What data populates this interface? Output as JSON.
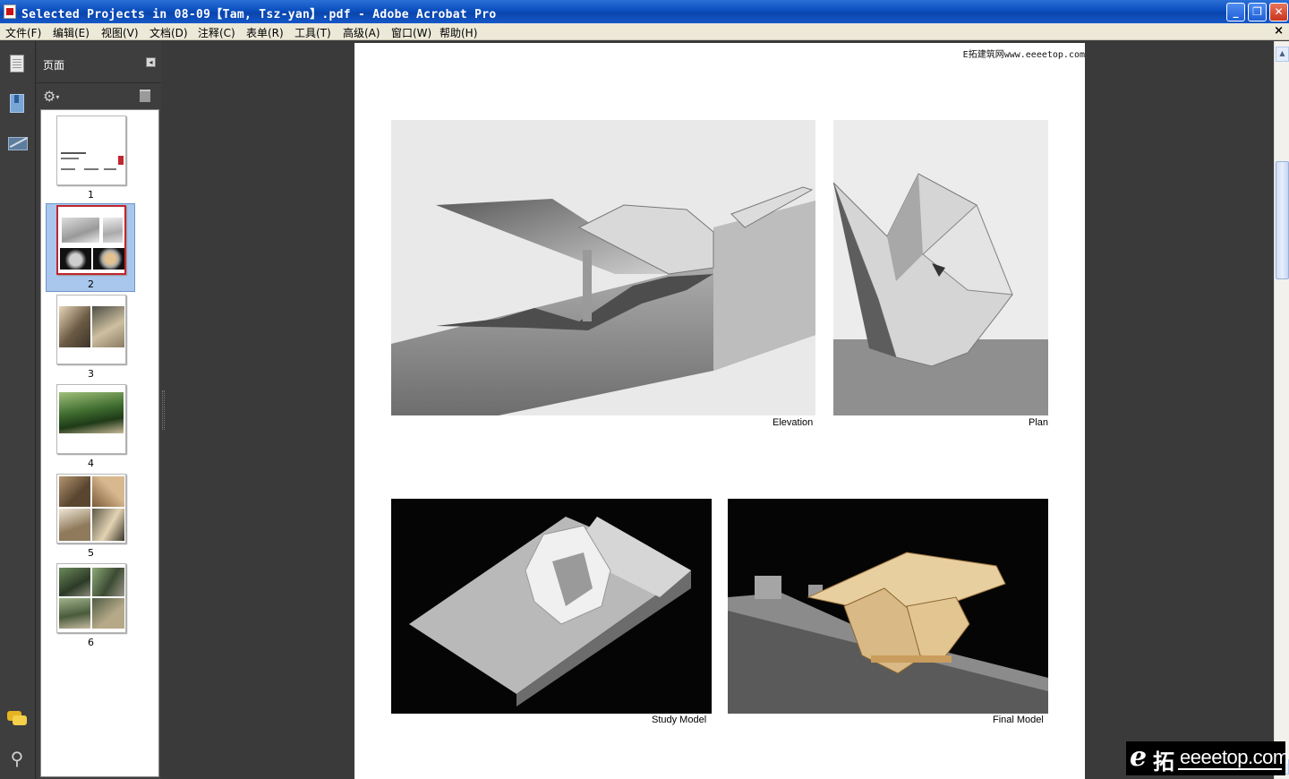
{
  "window": {
    "title": "Selected Projects in 08-09【Tam, Tsz-yan】.pdf - Adobe Acrobat Pro",
    "minimize_label": "_",
    "restore_label": "❐",
    "close_label": "✕"
  },
  "menu": {
    "items": [
      "文件(F)",
      "编辑(E)",
      "视图(V)",
      "文档(D)",
      "注释(C)",
      "表单(R)",
      "工具(T)",
      "高级(A)",
      "窗口(W)",
      "帮助(H)"
    ],
    "doc_close": "×"
  },
  "nav_icons": [
    "pages-icon",
    "bookmarks-icon",
    "signatures-icon",
    "comments-icon",
    "attachment-icon"
  ],
  "panel": {
    "title": "页面",
    "collapse_glyph": "◂",
    "options_glyph": "⚙",
    "options_caret": "▾",
    "thumbnails": [
      {
        "label": "1"
      },
      {
        "label": "2",
        "selected": true
      },
      {
        "label": "3"
      },
      {
        "label": "4"
      },
      {
        "label": "5"
      },
      {
        "label": "6"
      }
    ]
  },
  "page": {
    "watermark": "E拓建筑网www.eeeetop.com",
    "figures": [
      {
        "caption": "Elevation"
      },
      {
        "caption": "Plan"
      },
      {
        "caption": "Study Model"
      },
      {
        "caption": "Final Model"
      }
    ]
  },
  "scrollbar": {
    "up": "▲",
    "down": "▼"
  },
  "site_badge": {
    "e": "e",
    "cn": "拓",
    "domain": "eeeetop.com"
  },
  "colors": {
    "titlebar": "#0b4fbf",
    "selected_thumb_border": "#c0262d",
    "selection_bg": "#a9c7ec"
  }
}
